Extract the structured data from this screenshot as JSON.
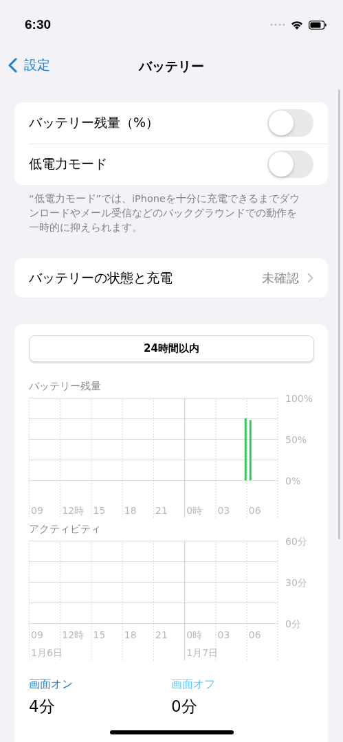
{
  "status_bar": {
    "time": "6:30"
  },
  "nav": {
    "back": "設定",
    "title": "バッテリー"
  },
  "toggles": [
    {
      "label": "バッテリー残量（%）",
      "on": false
    },
    {
      "label": "低電力モード",
      "on": false
    }
  ],
  "toggles_footer": "“低電力モード”では、iPhoneを十分に充電できるまでダウンロードやメール受信などのバックグラウンドでの動作を一時的に抑えられます。",
  "health_row": {
    "label": "バッテリーの状態と充電",
    "value": "未確認"
  },
  "range_button": "24時間以内",
  "battery_chart": {
    "label": "バッテリー残量",
    "chart_data": {
      "type": "bar",
      "grid": true,
      "ylim": [
        0,
        100
      ],
      "categories": [
        "09",
        null,
        null,
        "12時",
        null,
        null,
        "15",
        null,
        null,
        "18",
        null,
        null,
        "21",
        null,
        null,
        "0時",
        null,
        null,
        "03",
        null,
        null,
        "06",
        null,
        null
      ],
      "series": [
        {
          "color": "#34c759",
          "values": [
            null,
            null,
            null,
            null,
            null,
            null,
            null,
            null,
            null,
            null,
            null,
            null,
            null,
            null,
            null,
            null,
            null,
            null,
            null,
            null,
            75,
            73,
            null,
            null
          ]
        }
      ],
      "yticks": [
        {
          "value": 0,
          "label": "0%"
        },
        {
          "value": 50,
          "label": "50%"
        },
        {
          "value": 100,
          "label": "100%"
        }
      ]
    }
  },
  "activity_chart": {
    "label": "アクティビティ",
    "chart_data": {
      "type": "bar",
      "grid": true,
      "ylim": [
        0,
        60
      ],
      "categories": [
        "09",
        null,
        null,
        "12時",
        null,
        null,
        "15",
        null,
        null,
        "18",
        null,
        null,
        "21",
        null,
        null,
        "0時",
        null,
        null,
        "03",
        null,
        null,
        "06",
        null,
        null
      ],
      "yticks": [
        {
          "value": 0,
          "label": "0分"
        },
        {
          "value": 30,
          "label": "30分"
        },
        {
          "value": 60,
          "label": "60分"
        }
      ],
      "annotations": [
        "1月6日",
        "1月7日"
      ]
    }
  },
  "screen_stats": [
    {
      "label": "画面オン",
      "value": "4分",
      "color": "#1a7fd4"
    },
    {
      "label": "画面オフ",
      "value": "0分",
      "color": "#5ac8fa"
    }
  ]
}
